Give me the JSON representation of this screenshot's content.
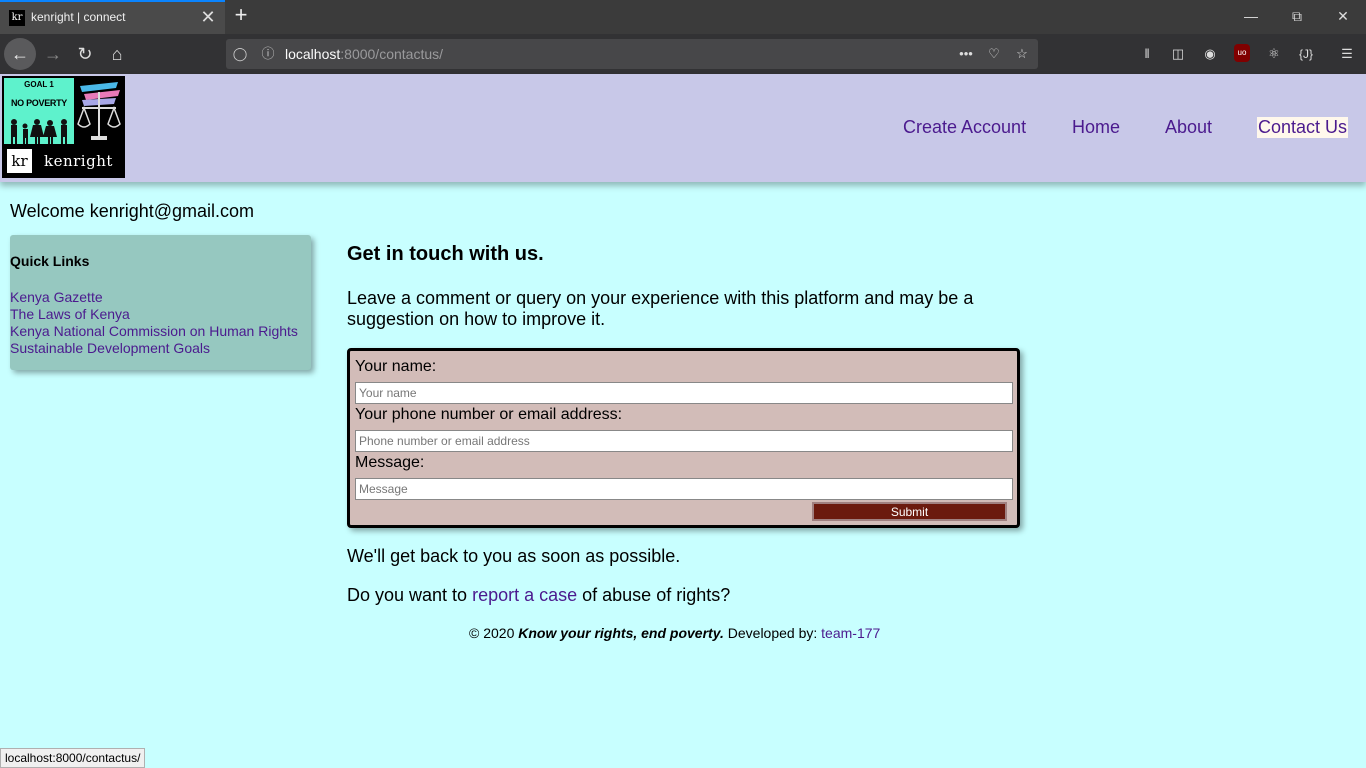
{
  "browser": {
    "tab_favicon": "kr",
    "tab_title": "kenright | connect",
    "tab_close": "✕",
    "new_tab": "+",
    "url_host": "localhost",
    "url_rest": ":8000/contactus/",
    "more": "•••",
    "status_url": "localhost:8000/contactus/"
  },
  "header": {
    "logo_goal": "GOAL 1",
    "logo_slogan": "NO POVERTY",
    "logo_initials": "kr",
    "logo_name": "kenright",
    "nav": [
      "Create Account",
      "Home",
      "About",
      "Contact Us"
    ]
  },
  "welcome": "Welcome kenright@gmail.com",
  "quick_links": {
    "title": "Quick Links",
    "items": [
      "Kenya Gazette",
      "The Laws of Kenya",
      "Kenya National Commission on Human Rights",
      "Sustainable Development Goals"
    ]
  },
  "main": {
    "title": "Get in touch with us.",
    "intro": "Leave a comment or query on your experience with this platform and may be a suggestion on how to improve it.",
    "form": {
      "name_label": "Your name:",
      "name_placeholder": "Your name",
      "contact_label": "Your phone number or email address:",
      "contact_placeholder": "Phone number or email address",
      "message_label": "Message:",
      "message_placeholder": "Message",
      "submit": "Submit"
    },
    "after_form": "We'll get back to you as soon as possible.",
    "report_prefix": "Do you want to ",
    "report_link": "report a case",
    "report_suffix": " of abuse of rights?"
  },
  "footer": {
    "copyright": "© 2020 ",
    "tagline": "Know your rights, end poverty.",
    "developed_by": " Developed by: ",
    "team_link": "team-177"
  },
  "colors": {
    "page_bg": "#c8ffff",
    "header_bg": "#c8c8e8",
    "link": "#4b1a8e",
    "quicklinks_bg": "#96c8c0",
    "form_bg": "#d2bcb8",
    "submit_bg": "#6b1a0e"
  }
}
